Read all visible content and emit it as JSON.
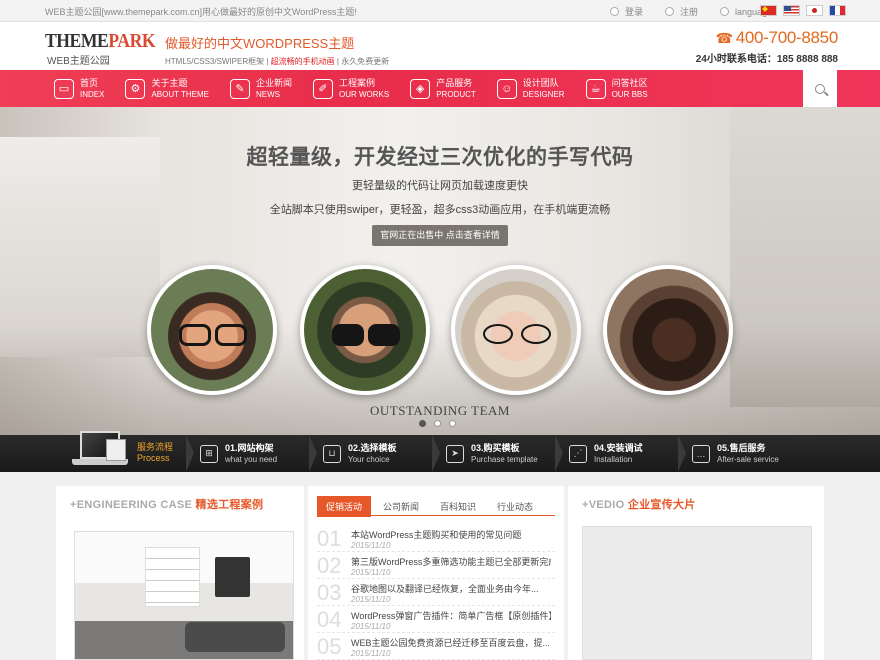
{
  "topbar": {
    "note": "WEB主题公园[www.themepark.com.cn]用心做最好的原创中文WordPress主题!",
    "login": "登录",
    "register": "注册",
    "language": "language"
  },
  "header": {
    "logo_main_a": "THEME",
    "logo_main_b": "PARK",
    "logo_sub": "WEB主题公园",
    "slogan_title": "做最好的中文WORDPRESS主题",
    "slogan_sub_a": "HTML5/CSS3/SWIPER框架",
    "slogan_sub_b": "超流畅的手机动画",
    "slogan_sub_c": "永久免费更新",
    "phone": "400-700-8850",
    "hotline": "24小时联系电话：185 8888 888"
  },
  "nav": {
    "items": [
      {
        "cn": "首页",
        "en": "INDEX",
        "icon": "monitor-icon"
      },
      {
        "cn": "关于主题",
        "en": "ABOUT THEME",
        "icon": "gear-icon"
      },
      {
        "cn": "企业新闻",
        "en": "NEWS",
        "icon": "edit-icon"
      },
      {
        "cn": "工程案例",
        "en": "OUR WORKS",
        "icon": "pencil-icon"
      },
      {
        "cn": "产品服务",
        "en": "PRODUCT",
        "icon": "tag-icon"
      },
      {
        "cn": "设计团队",
        "en": "DESIGNER",
        "icon": "team-icon"
      },
      {
        "cn": "问答社区",
        "en": "OUR BBS",
        "icon": "cup-icon"
      }
    ]
  },
  "hero": {
    "title": "超轻量级，开发经过三次优化的手写代码",
    "line1": "更轻量级的代码让网页加载速度更快",
    "line2": "全站脚本只使用swiper，更轻盈，超多css3动画应用，在手机端更流畅",
    "button": "官网正在出售中 点击查看详情",
    "team": "OUTSTANDING TEAM"
  },
  "process": {
    "title_cn": "服务流程",
    "title_en": "Process",
    "steps": [
      {
        "cn": "01.网站构架",
        "en": "what you need",
        "icon": "sitemap-icon"
      },
      {
        "cn": "02.选择模板",
        "en": "Your choice",
        "icon": "basket-icon"
      },
      {
        "cn": "03.购买模板",
        "en": "Purchase template",
        "icon": "send-icon"
      },
      {
        "cn": "04.安装调试",
        "en": "Installation",
        "icon": "share-icon"
      },
      {
        "cn": "05.售后服务",
        "en": "After-sale service",
        "icon": "chat-icon"
      }
    ]
  },
  "case": {
    "title_en": "+ENGINEERING CASE",
    "title_cn": "精选工程案例"
  },
  "news": {
    "tabs": [
      "促销活动",
      "公司新闻",
      "百科知识",
      "行业动态"
    ],
    "items": [
      {
        "num": "01",
        "title": "本站WordPress主题购买和使用的常见问题",
        "date": "2015/11/10"
      },
      {
        "num": "02",
        "title": "第三版WordPress多重筛选功能主题已全部更新完成",
        "date": "2015/11/10"
      },
      {
        "num": "03",
        "title": "谷歌地图以及翻译已经恢复，全面业务由今年...",
        "date": "2015/11/10"
      },
      {
        "num": "04",
        "title": "WordPress弹窗广告插件：简单广告框【原创插件】",
        "date": "2015/11/10"
      },
      {
        "num": "05",
        "title": "WEB主题公园免费资源已经迁移至百度云盘，提...",
        "date": "2015/11/10"
      }
    ]
  },
  "video": {
    "title_en": "+VEDIO",
    "title_cn": "企业宣传大片"
  }
}
